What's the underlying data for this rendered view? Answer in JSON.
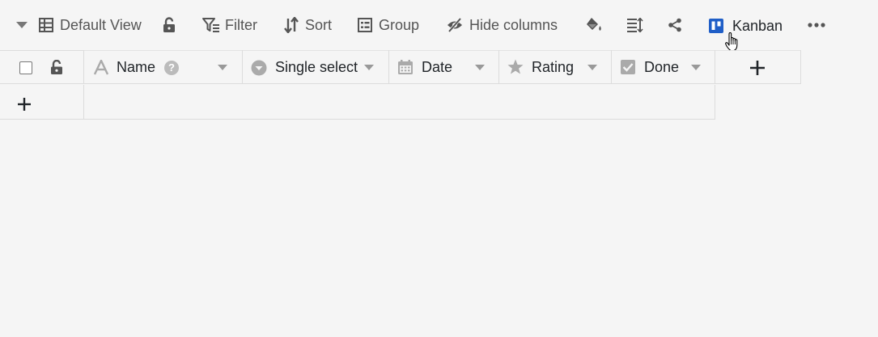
{
  "toolbar": {
    "view_name": "Default View",
    "filter_label": "Filter",
    "sort_label": "Sort",
    "group_label": "Group",
    "hide_columns_label": "Hide columns",
    "kanban_label": "Kanban"
  },
  "columns": [
    {
      "name": "Name",
      "icon": "text-icon"
    },
    {
      "name": "Single select",
      "icon": "single-select-icon"
    },
    {
      "name": "Date",
      "icon": "calendar-icon"
    },
    {
      "name": "Rating",
      "icon": "star-icon"
    },
    {
      "name": "Done",
      "icon": "checkbox-icon"
    }
  ],
  "colors": {
    "accent": "#1f5ec7",
    "icon_gray": "#555555",
    "header_icon": "#aaaaaa",
    "background": "#f5f5f5",
    "border": "#dcdcdc"
  }
}
